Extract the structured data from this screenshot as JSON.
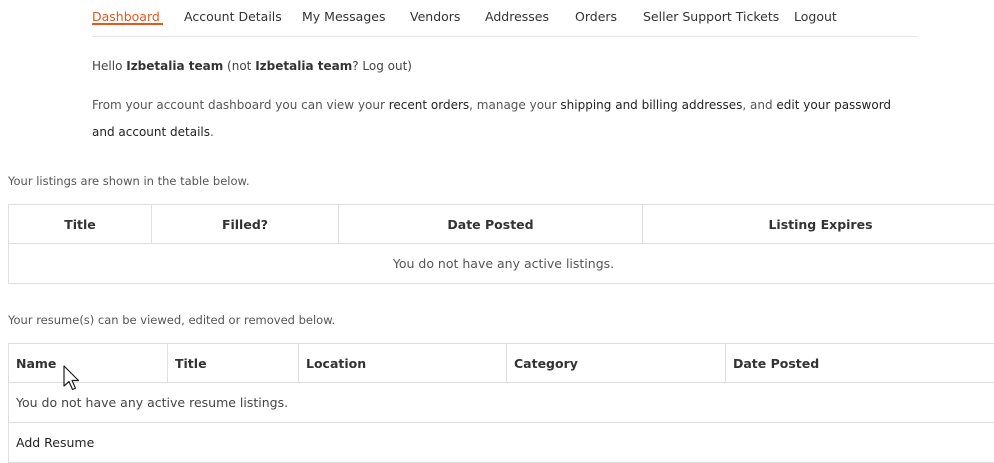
{
  "nav": {
    "items": [
      {
        "label": "Dashboard",
        "active": true
      },
      {
        "label": "Account Details",
        "active": false
      },
      {
        "label": "My Messages",
        "active": false
      },
      {
        "label": "Vendors",
        "active": false
      },
      {
        "label": "Addresses",
        "active": false
      },
      {
        "label": "Orders",
        "active": false
      },
      {
        "label": "Seller Support Tickets",
        "active": false
      },
      {
        "label": "Logout",
        "active": false
      }
    ],
    "accent_color": "#e2581f"
  },
  "greeting": {
    "hello": "Hello ",
    "user": "Izbetalia team",
    "not_prefix": " (not ",
    "user2": "Izbetalia team",
    "logout_link": "? Log out)"
  },
  "intro": {
    "part1": "From your account dashboard you can view your ",
    "recent_orders": "recent orders",
    "part2": ", manage your ",
    "addresses": "shipping and billing addresses",
    "part3": ", and ",
    "edit": "edit your password and account details",
    "part4": "."
  },
  "listings": {
    "caption": "Your listings are shown in the table below.",
    "headers": [
      "Title",
      "Filled?",
      "Date Posted",
      "Listing Expires"
    ],
    "empty": "You do not have any active listings."
  },
  "resumes": {
    "caption": "Your resume(s) can be viewed, edited or removed below.",
    "headers": [
      "Name",
      "Title",
      "Location",
      "Category",
      "Date Posted"
    ],
    "empty": "You do not have any active resume listings.",
    "add": "Add Resume"
  }
}
